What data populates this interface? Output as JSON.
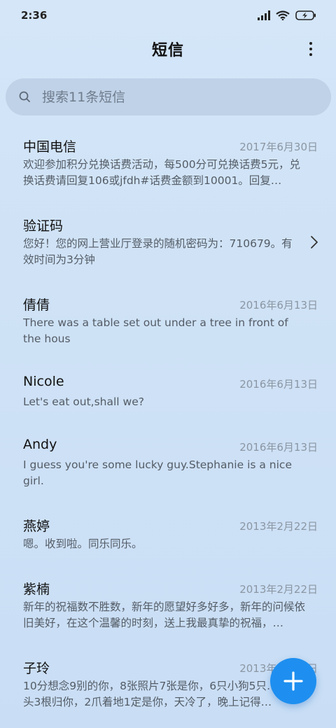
{
  "status_bar": {
    "time": "2:36"
  },
  "header": {
    "title": "短信"
  },
  "search": {
    "placeholder": "搜索11条短信"
  },
  "messages": [
    {
      "name": "中国电信",
      "date": "2017年6月30日",
      "preview": "欢迎参加积分兑换话费活动，每500分可兑换话费5元，兑换话费请回复106或jfdh#话费金额到10001。回复…"
    },
    {
      "name": "验证码",
      "date": "",
      "preview": "您好！您的网上营业厅登录的随机密码为：710679。有效时间为3分钟"
    },
    {
      "name": "倩倩",
      "date": "2016年6月13日",
      "preview": "There was a table set out under a tree in front of the hous"
    },
    {
      "name": "Nicole",
      "date": "2016年6月13日",
      "preview": "Let's eat out,shall we?"
    },
    {
      "name": "Andy",
      "date": "2016年6月13日",
      "preview": "I guess you're some lucky guy.Stephanie is a nice girl."
    },
    {
      "name": "燕婷",
      "date": "2013年2月22日",
      "preview": "嗯。收到啦。同乐同乐。"
    },
    {
      "name": "紫楠",
      "date": "2013年2月22日",
      "preview": "新年的祝福数不胜数，新年的愿望好多好多，新年的问候依旧美好，在这个温馨的时刻，送上我最真挚的祝福，…"
    },
    {
      "name": "子玲",
      "date": "2013年2月22日",
      "preview": "10分想念9别的你，8张照片7张是你，6只小狗5只…4根骨头3根归你，2爪着地1定是你，天冷了，晚上记得…"
    }
  ],
  "colors": {
    "accent": "#1e8ff0",
    "date_text": "#8b96a3",
    "preview_text": "#545c66"
  },
  "icons": {
    "signal": "signal-icon",
    "wifi": "wifi-icon",
    "battery": "battery-charging-icon",
    "more": "more-vertical-icon",
    "search": "search-icon",
    "chevron": "chevron-right-icon",
    "compose": "plus-icon"
  }
}
